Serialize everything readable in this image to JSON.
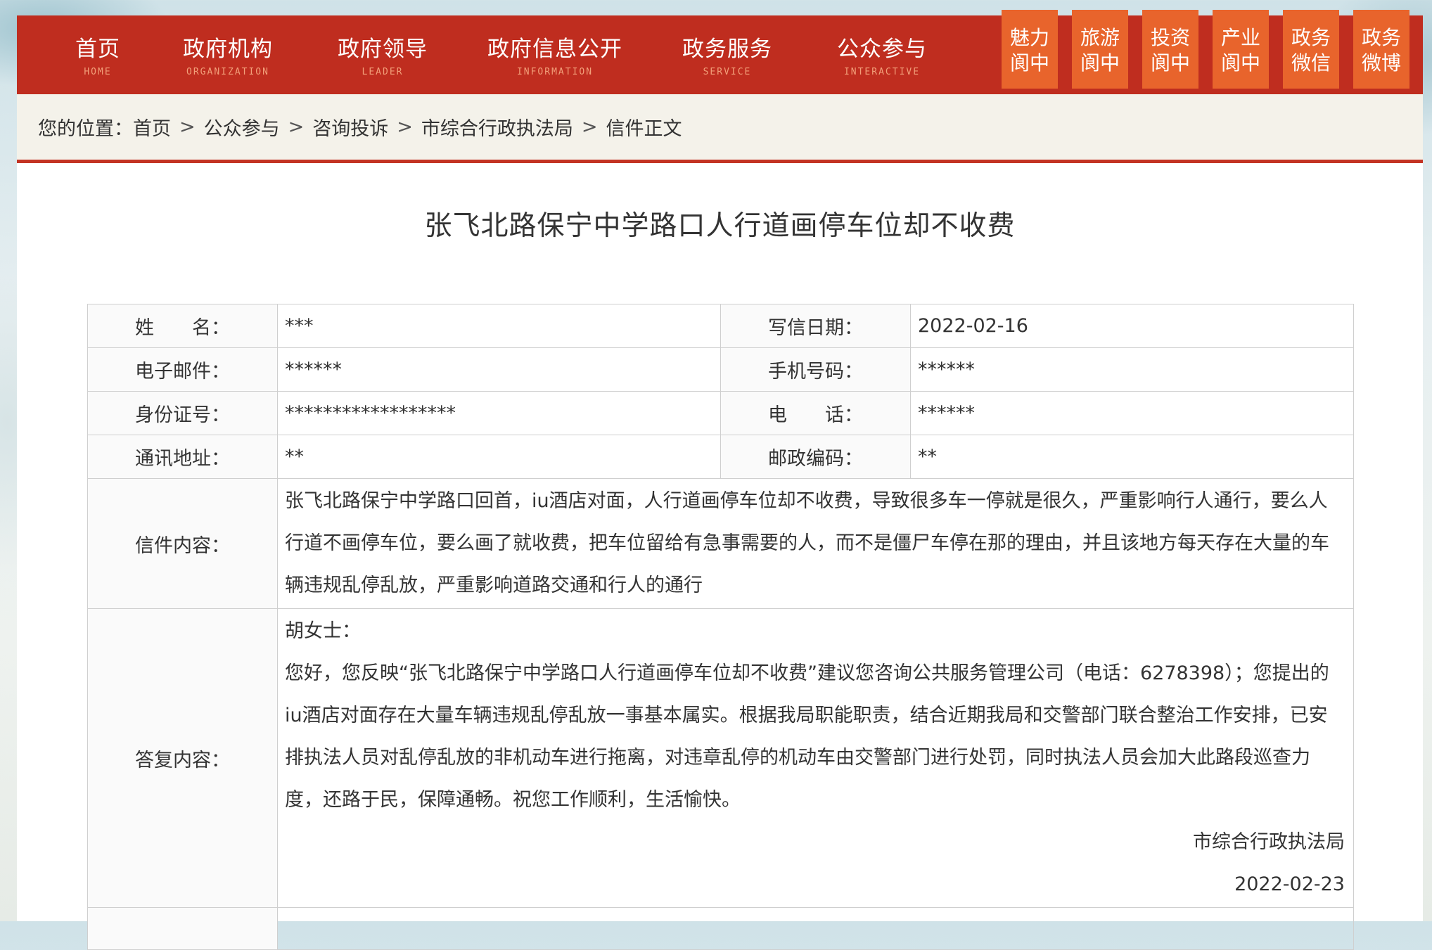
{
  "nav": {
    "items": [
      {
        "cn": "首页",
        "en": "HOME"
      },
      {
        "cn": "政府机构",
        "en": "ORGANIZATION"
      },
      {
        "cn": "政府领导",
        "en": "LEADER"
      },
      {
        "cn": "政府信息公开",
        "en": "INFORMATION"
      },
      {
        "cn": "政务服务",
        "en": "SERVICE"
      },
      {
        "cn": "公众参与",
        "en": "INTERACTIVE"
      }
    ],
    "quick": [
      {
        "l1": "魅力",
        "l2": "阆中"
      },
      {
        "l1": "旅游",
        "l2": "阆中"
      },
      {
        "l1": "投资",
        "l2": "阆中"
      },
      {
        "l1": "产业",
        "l2": "阆中"
      },
      {
        "l1": "政务",
        "l2": "微信"
      },
      {
        "l1": "政务",
        "l2": "微博"
      }
    ]
  },
  "breadcrumb": {
    "prefix": "您的位置：",
    "items": [
      "首页",
      "公众参与",
      "咨询投诉",
      "市综合行政执法局",
      "信件正文"
    ],
    "separator": ">"
  },
  "letter": {
    "title": "张飞北路保宁中学路口人行道画停车位却不收费",
    "name_label": "姓　　名：",
    "name": "***",
    "date_label": "写信日期：",
    "date": "2022-02-16",
    "email_label": "电子邮件：",
    "email": "******",
    "mobile_label": "手机号码：",
    "mobile": "******",
    "id_label": "身份证号：",
    "id": "******************",
    "phone_label": "电　　话：",
    "phone": "******",
    "address_label": "通讯地址：",
    "address": "**",
    "postcode_label": "邮政编码：",
    "postcode": "**",
    "content_label": "信件内容：",
    "content": "张飞北路保宁中学路口回首，iu酒店对面，人行道画停车位却不收费，导致很多车一停就是很久，严重影响行人通行，要么人行道不画停车位，要么画了就收费，把车位留给有急事需要的人，而不是僵尸车停在那的理由，并且该地方每天存在大量的车辆违规乱停乱放，严重影响道路交通和行人的通行",
    "reply_label": "答复内容：",
    "reply_greeting": "胡女士：",
    "reply_body": "您好，您反映“张飞北路保宁中学路口人行道画停车位却不收费”建议您咨询公共服务管理公司（电话：6278398）；您提出的iu酒店对面存在大量车辆违规乱停乱放一事基本属实。根据我局职能职责，结合近期我局和交警部门联合整治工作安排，已安排执法人员对乱停乱放的非机动车进行拖离，对违章乱停的机动车由交警部门进行处罚，同时执法人员会加大此路段巡查力度，还路于民，保障通畅。祝您工作顺利，生活愉快。",
    "reply_org": "市综合行政执法局",
    "reply_date": "2022-02-23"
  },
  "colors": {
    "nav_bg": "#bf2d1f",
    "quick_bg": "#e8642c",
    "crumb_bg": "#f4f2ea",
    "accent_line": "#c33424"
  }
}
